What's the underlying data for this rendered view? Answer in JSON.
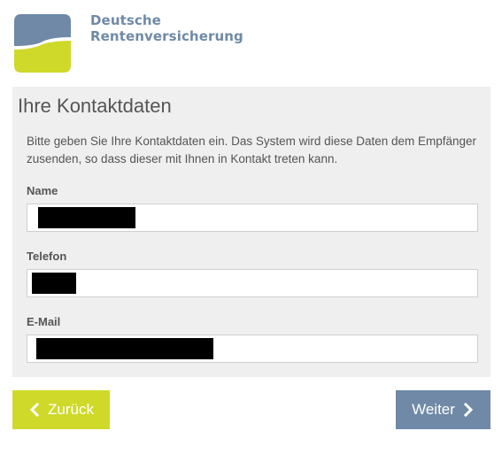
{
  "brand": {
    "line1": "Deutsche",
    "line2": "Rentenversicherung",
    "colors": {
      "blue": "#6f89a7",
      "lime": "#cfd92a"
    }
  },
  "form": {
    "title": "Ihre Kontaktdaten",
    "description": "Bitte geben Sie Ihre Kontaktdaten ein. Das System wird diese Daten dem Empfänger zusenden, so dass dieser mit Ihnen in Kontakt treten kann.",
    "fields": [
      {
        "label": "Name",
        "value": ""
      },
      {
        "label": "Telefon",
        "value": ""
      },
      {
        "label": "E-Mail",
        "value": ""
      }
    ]
  },
  "buttons": {
    "back": {
      "label": "Zurück",
      "icon": "chevron-left-icon"
    },
    "next": {
      "label": "Weiter",
      "icon": "chevron-right-icon"
    }
  }
}
